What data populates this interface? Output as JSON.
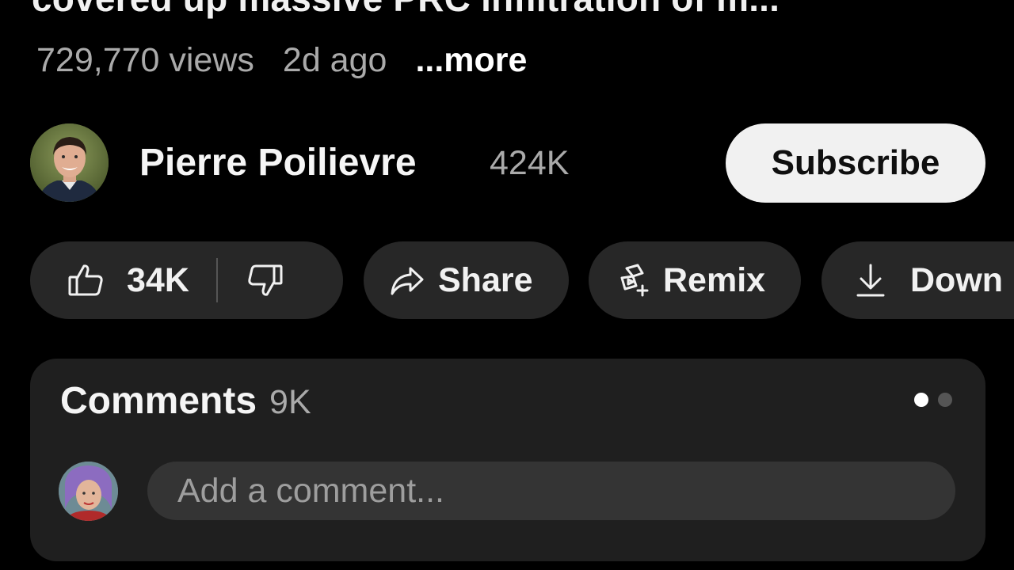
{
  "video": {
    "title": "covered up massive PRC infiltration of m...",
    "views": "729,770 views",
    "date": "2d ago",
    "more_label": "...more"
  },
  "channel": {
    "name": "Pierre Poilievre",
    "subscribers": "424K",
    "subscribe_label": "Subscribe",
    "avatar_icon": "channel-avatar-photo"
  },
  "actions": {
    "like_count": "34K",
    "like_icon": "thumbs-up-icon",
    "dislike_icon": "thumbs-down-icon",
    "share_label": "Share",
    "share_icon": "share-arrow-icon",
    "remix_label": "Remix",
    "remix_icon": "remix-icon",
    "download_label": "Down",
    "download_icon": "download-icon"
  },
  "comments": {
    "title": "Comments",
    "count": "9K",
    "input_placeholder": "Add a comment...",
    "page_indicator": {
      "total": 2,
      "active": 1
    }
  },
  "colors": {
    "background": "#000000",
    "pill": "#272727",
    "card": "#1f1f1f",
    "input": "#343434",
    "secondary_text": "#aaaaaa",
    "subscribe_bg": "#f1f1f1"
  }
}
